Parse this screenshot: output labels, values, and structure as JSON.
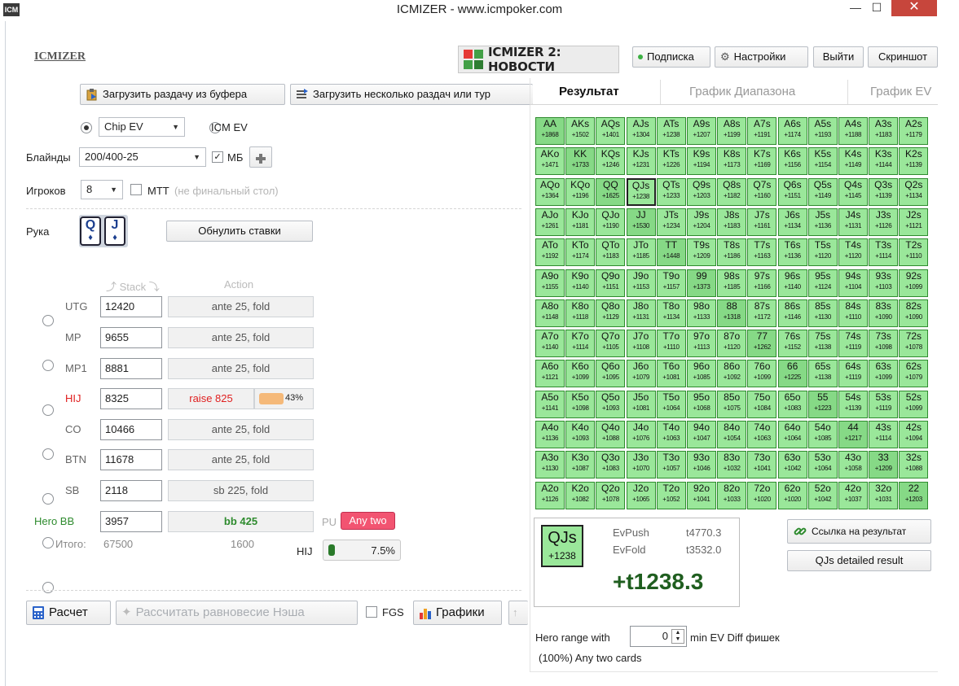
{
  "window": {
    "title": "ICMIZER - www.icmpoker.com",
    "icon_text": "ICM",
    "close": "✕",
    "minimize": "—",
    "maximize": "☐"
  },
  "header": {
    "logo": "ICMIZER",
    "banner": "ICMIZER 2: НОВОСТИ",
    "subscribe": "Подписка",
    "settings": "Настройки",
    "logout": "Выйти",
    "screenshot": "Скриншот"
  },
  "toolbar": {
    "load_clipboard": "Загрузить раздачу из буфера",
    "load_multiple": "Загрузить несколько раздач или тур"
  },
  "mode": {
    "chip_ev": "Chip EV",
    "icm_ev": "ICM EV"
  },
  "blinds": {
    "label": "Блайнды",
    "value": "200/400-25",
    "mb": "МБ"
  },
  "players": {
    "label": "Игроков",
    "value": "8",
    "mtt": "MTT",
    "mtt_note": "(не финальный стол)"
  },
  "hand": {
    "label": "Рука",
    "card1": "Q",
    "card2": "J",
    "reset": "Обнулить ставки"
  },
  "columns": {
    "stack": "Stack",
    "action": "Action"
  },
  "seats": [
    {
      "pos": "UTG",
      "stack": "12420",
      "action": "ante 25, fold"
    },
    {
      "pos": "MP",
      "stack": "9655",
      "action": "ante 25, fold"
    },
    {
      "pos": "MP1",
      "stack": "8881",
      "action": "ante 25, fold"
    },
    {
      "pos": "HIJ",
      "stack": "8325",
      "action": "raise 825",
      "pct": "43%"
    },
    {
      "pos": "CO",
      "stack": "10466",
      "action": "ante 25, fold"
    },
    {
      "pos": "BTN",
      "stack": "11678",
      "action": "ante 25, fold"
    },
    {
      "pos": "SB",
      "stack": "2118",
      "action": "sb 225, fold"
    },
    {
      "pos": "Hero BB",
      "stack": "3957",
      "action": "bb 425",
      "pu": "PU",
      "range": "Any two"
    }
  ],
  "totals": {
    "label": "Итого:",
    "stack": "67500",
    "pot": "1600",
    "hij_label": "HIJ",
    "hij_pct": "7.5%"
  },
  "bottom": {
    "calc": "Расчет",
    "nash": "Рассчитать равновесие Нэша",
    "fgs": "FGS",
    "charts": "Графики"
  },
  "tabs": {
    "result": "Результат",
    "range_chart": "График Диапазона",
    "ev_chart": "График EV"
  },
  "grid": [
    [
      "AA",
      "+1868",
      "AKs",
      "+1502",
      "AQs",
      "+1401",
      "AJs",
      "+1304",
      "ATs",
      "+1238",
      "A9s",
      "+1207",
      "A8s",
      "+1199",
      "A7s",
      "+1191",
      "A6s",
      "+1174",
      "A5s",
      "+1193",
      "A4s",
      "+1188",
      "A3s",
      "+1183",
      "A2s",
      "+1179"
    ],
    [
      "AKo",
      "+1471",
      "KK",
      "+1733",
      "KQs",
      "+1246",
      "KJs",
      "+1231",
      "KTs",
      "+1226",
      "K9s",
      "+1194",
      "K8s",
      "+1173",
      "K7s",
      "+1169",
      "K6s",
      "+1156",
      "K5s",
      "+1154",
      "K4s",
      "+1149",
      "K3s",
      "+1144",
      "K2s",
      "+1139"
    ],
    [
      "AQo",
      "+1364",
      "KQo",
      "+1196",
      "QQ",
      "+1625",
      "QJs",
      "+1238",
      "QTs",
      "+1233",
      "Q9s",
      "+1203",
      "Q8s",
      "+1182",
      "Q7s",
      "+1160",
      "Q6s",
      "+1151",
      "Q5s",
      "+1149",
      "Q4s",
      "+1145",
      "Q3s",
      "+1139",
      "Q2s",
      "+1134"
    ],
    [
      "AJo",
      "+1261",
      "KJo",
      "+1181",
      "QJo",
      "+1190",
      "JJ",
      "+1530",
      "JTs",
      "+1234",
      "J9s",
      "+1204",
      "J8s",
      "+1183",
      "J7s",
      "+1161",
      "J6s",
      "+1134",
      "J5s",
      "+1136",
      "J4s",
      "+1131",
      "J3s",
      "+1126",
      "J2s",
      "+1121"
    ],
    [
      "ATo",
      "+1192",
      "KTo",
      "+1174",
      "QTo",
      "+1183",
      "JTo",
      "+1185",
      "TT",
      "+1448",
      "T9s",
      "+1209",
      "T8s",
      "+1186",
      "T7s",
      "+1163",
      "T6s",
      "+1136",
      "T5s",
      "+1120",
      "T4s",
      "+1120",
      "T3s",
      "+1114",
      "T2s",
      "+1110"
    ],
    [
      "A9o",
      "+1155",
      "K9o",
      "+1140",
      "Q9o",
      "+1151",
      "J9o",
      "+1153",
      "T9o",
      "+1157",
      "99",
      "+1373",
      "98s",
      "+1185",
      "97s",
      "+1166",
      "96s",
      "+1140",
      "95s",
      "+1124",
      "94s",
      "+1104",
      "93s",
      "+1103",
      "92s",
      "+1099"
    ],
    [
      "A8o",
      "+1148",
      "K8o",
      "+1118",
      "Q8o",
      "+1129",
      "J8o",
      "+1131",
      "T8o",
      "+1134",
      "98o",
      "+1133",
      "88",
      "+1318",
      "87s",
      "+1172",
      "86s",
      "+1146",
      "85s",
      "+1130",
      "84s",
      "+1110",
      "83s",
      "+1090",
      "82s",
      "+1090"
    ],
    [
      "A7o",
      "+1140",
      "K7o",
      "+1114",
      "Q7o",
      "+1105",
      "J7o",
      "+1108",
      "T7o",
      "+1110",
      "97o",
      "+1113",
      "87o",
      "+1120",
      "77",
      "+1262",
      "76s",
      "+1152",
      "75s",
      "+1138",
      "74s",
      "+1119",
      "73s",
      "+1098",
      "72s",
      "+1078"
    ],
    [
      "A6o",
      "+1121",
      "K6o",
      "+1099",
      "Q6o",
      "+1095",
      "J6o",
      "+1079",
      "T6o",
      "+1081",
      "96o",
      "+1085",
      "86o",
      "+1092",
      "76o",
      "+1099",
      "66",
      "+1225",
      "65s",
      "+1138",
      "64s",
      "+1119",
      "63s",
      "+1099",
      "62s",
      "+1079"
    ],
    [
      "A5o",
      "+1141",
      "K5o",
      "+1098",
      "Q5o",
      "+1093",
      "J5o",
      "+1081",
      "T5o",
      "+1064",
      "95o",
      "+1068",
      "85o",
      "+1075",
      "75o",
      "+1084",
      "65o",
      "+1083",
      "55",
      "+1223",
      "54s",
      "+1139",
      "53s",
      "+1119",
      "52s",
      "+1099"
    ],
    [
      "A4o",
      "+1136",
      "K4o",
      "+1093",
      "Q4o",
      "+1088",
      "J4o",
      "+1076",
      "T4o",
      "+1063",
      "94o",
      "+1047",
      "84o",
      "+1054",
      "74o",
      "+1063",
      "64o",
      "+1064",
      "54o",
      "+1085",
      "44",
      "+1217",
      "43s",
      "+1114",
      "42s",
      "+1094"
    ],
    [
      "A3o",
      "+1130",
      "K3o",
      "+1087",
      "Q3o",
      "+1083",
      "J3o",
      "+1070",
      "T3o",
      "+1057",
      "93o",
      "+1046",
      "83o",
      "+1032",
      "73o",
      "+1041",
      "63o",
      "+1042",
      "53o",
      "+1064",
      "43o",
      "+1058",
      "33",
      "+1209",
      "32s",
      "+1088"
    ],
    [
      "A2o",
      "+1126",
      "K2o",
      "+1082",
      "Q2o",
      "+1078",
      "J2o",
      "+1065",
      "T2o",
      "+1052",
      "92o",
      "+1041",
      "82o",
      "+1033",
      "72o",
      "+1020",
      "62o",
      "+1020",
      "52o",
      "+1042",
      "42o",
      "+1037",
      "32o",
      "+1031",
      "22",
      "+1203"
    ]
  ],
  "result": {
    "hand": "QJs",
    "hand_ev": "+1238",
    "evpush_label": "EvPush",
    "evpush": "t4770.3",
    "evfold_label": "EvFold",
    "evfold": "t3532.0",
    "diff": "+t1238.3",
    "link": "Ссылка на результат",
    "detailed": "QJs detailed result"
  },
  "hero_range": {
    "label": "Hero range with",
    "value": "0",
    "suffix": "min EV Diff фишек",
    "summary": "(100%) Any two cards"
  }
}
